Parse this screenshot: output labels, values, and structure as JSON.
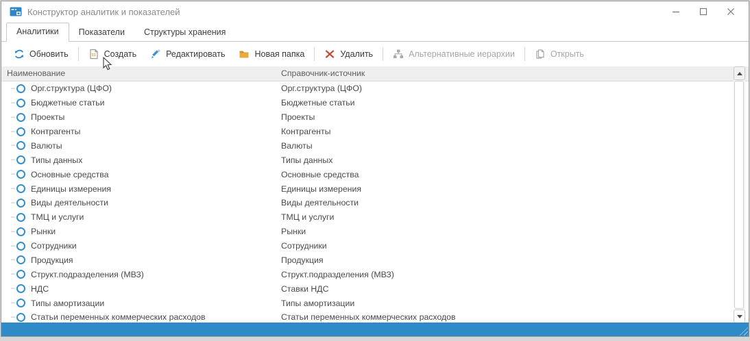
{
  "window": {
    "title": "Конструктор аналитик и показателей",
    "controls": [
      {
        "icon": "minimize-icon"
      },
      {
        "icon": "maximize-icon"
      },
      {
        "icon": "close-icon"
      }
    ]
  },
  "tabs": [
    {
      "label": "Аналитики",
      "active": true
    },
    {
      "label": "Показатели",
      "active": false
    },
    {
      "label": "Структуры хранения",
      "active": false
    }
  ],
  "toolbar": {
    "buttons": [
      {
        "label": "Обновить",
        "icon": "refresh-icon",
        "enabled": true
      },
      {
        "label": "Создать",
        "icon": "new-document-icon",
        "enabled": true
      },
      {
        "label": "Редактировать",
        "icon": "pencil-icon",
        "enabled": true
      },
      {
        "label": "Новая папка",
        "icon": "folder-icon",
        "enabled": true
      },
      {
        "label": "Удалить",
        "icon": "delete-x-icon",
        "enabled": true
      },
      {
        "label": "Альтернативные иерархии",
        "icon": "hierarchy-icon",
        "enabled": false
      },
      {
        "label": "Открыть",
        "icon": "open-document-icon",
        "enabled": false
      }
    ]
  },
  "table": {
    "columns": [
      "Наименование",
      "Справочник-источник"
    ],
    "rows": [
      {
        "name": "Орг.структура (ЦФО)",
        "source": "Орг.структура (ЦФО)"
      },
      {
        "name": "Бюджетные статьи",
        "source": "Бюджетные статьи"
      },
      {
        "name": "Проекты",
        "source": "Проекты"
      },
      {
        "name": "Контрагенты",
        "source": "Контрагенты"
      },
      {
        "name": "Валюты",
        "source": "Валюты"
      },
      {
        "name": "Типы данных",
        "source": "Типы данных"
      },
      {
        "name": "Основные средства",
        "source": "Основные средства"
      },
      {
        "name": "Единицы измерения",
        "source": "Единицы измерения"
      },
      {
        "name": "Виды деятельности",
        "source": "Виды деятельности"
      },
      {
        "name": "ТМЦ и услуги",
        "source": "ТМЦ и услуги"
      },
      {
        "name": "Рынки",
        "source": "Рынки"
      },
      {
        "name": "Сотрудники",
        "source": "Сотрудники"
      },
      {
        "name": "Продукция",
        "source": "Продукция"
      },
      {
        "name": "Структ.подразделения (МВЗ)",
        "source": "Структ.подразделения (МВЗ)"
      },
      {
        "name": "НДС",
        "source": "Ставки НДС"
      },
      {
        "name": "Типы амортизации",
        "source": "Типы амортизации"
      },
      {
        "name": "Статьи переменных коммерческих расходов",
        "source": "Статьи переменных коммерческих расходов"
      }
    ]
  },
  "colors": {
    "accent_blue": "#2e8bc7",
    "status_bar_blue": "#2e8bc7",
    "folder_orange": "#edaa3c",
    "delete_red": "#c34a36",
    "disabled_gray": "#a6a6a6"
  }
}
